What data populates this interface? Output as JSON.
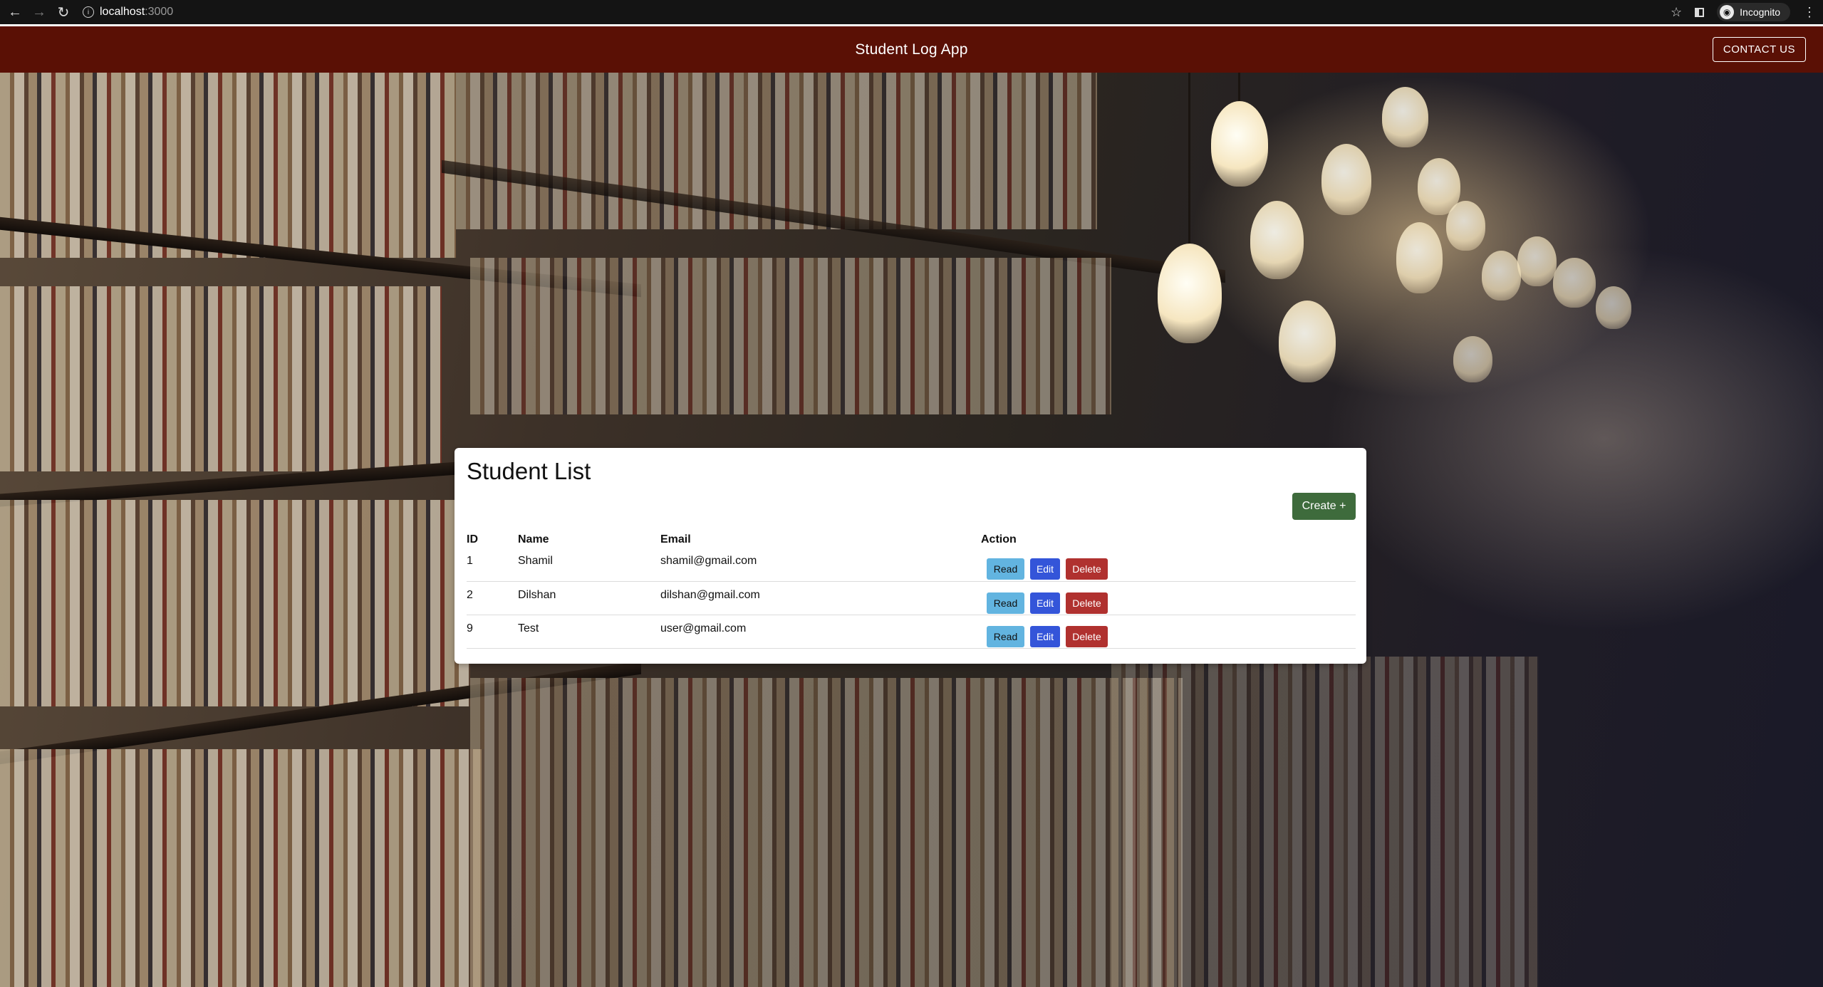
{
  "browser": {
    "url_host": "localhost",
    "url_port": ":3000",
    "profile_label": "Incognito"
  },
  "appbar": {
    "title": "Student Log App",
    "contact_label": "CONTACT US"
  },
  "card": {
    "title": "Student List",
    "create_label": "Create +",
    "columns": [
      "ID",
      "Name",
      "Email",
      "Action"
    ],
    "rows": [
      {
        "id": "1",
        "name": "Shamil",
        "email": "shamil@gmail.com"
      },
      {
        "id": "2",
        "name": "Dilshan",
        "email": "dilshan@gmail.com"
      },
      {
        "id": "9",
        "name": "Test",
        "email": "user@gmail.com"
      }
    ],
    "actions": {
      "read": "Read",
      "edit": "Edit",
      "delete": "Delete"
    }
  },
  "colors": {
    "appbar": "#5a1005",
    "create": "#3e6b3c",
    "read": "#62b4e0",
    "edit": "#3455d9",
    "delete": "#b0312f"
  }
}
